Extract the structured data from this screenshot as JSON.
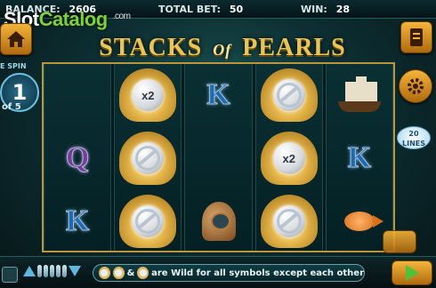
{
  "header": {
    "balance_label": "BALANCE:",
    "balance_value": "2606",
    "total_bet_label": "TOTAL BET:",
    "total_bet_value": "50",
    "win_label": "WIN:",
    "win_value": "28"
  },
  "watermark": {
    "part1": "Slot",
    "part2": "Catalog",
    "suffix": ".com"
  },
  "logo": {
    "word1": "STACKS",
    "of": "Of",
    "word2": "PEARLS"
  },
  "free_spins": {
    "label": "E SPIN",
    "current": "1",
    "of": "of 5"
  },
  "lines_badge": {
    "count": "20",
    "label": "LINES"
  },
  "reels": [
    [
      {
        "type": "blank"
      },
      {
        "type": "letter",
        "text": "Q",
        "color": "purple"
      },
      {
        "type": "letter",
        "text": "K",
        "color": "blue"
      }
    ],
    [
      {
        "type": "pearl",
        "text": "x2"
      },
      {
        "type": "pearl",
        "text": "wild"
      },
      {
        "type": "pearl",
        "text": "wild"
      }
    ],
    [
      {
        "type": "letter",
        "text": "K",
        "color": "blue"
      },
      {
        "type": "blank"
      },
      {
        "type": "helmet"
      }
    ],
    [
      {
        "type": "pearl",
        "text": "wild"
      },
      {
        "type": "pearl",
        "text": "x2"
      },
      {
        "type": "pearl",
        "text": "wild"
      }
    ],
    [
      {
        "type": "ship"
      },
      {
        "type": "letter",
        "text": "K",
        "color": "blue"
      },
      {
        "type": "fish"
      }
    ]
  ],
  "rules_text": "are Wild for all symbols except each other",
  "rules_amp": "&",
  "icons": {
    "home": "home-icon",
    "paytable": "document-icon",
    "settings": "gear-icon",
    "spin": "play-icon"
  },
  "colors": {
    "accent": "#e9c557",
    "spin_green": "#4fc23a",
    "button_orange": "#f4b53a"
  }
}
